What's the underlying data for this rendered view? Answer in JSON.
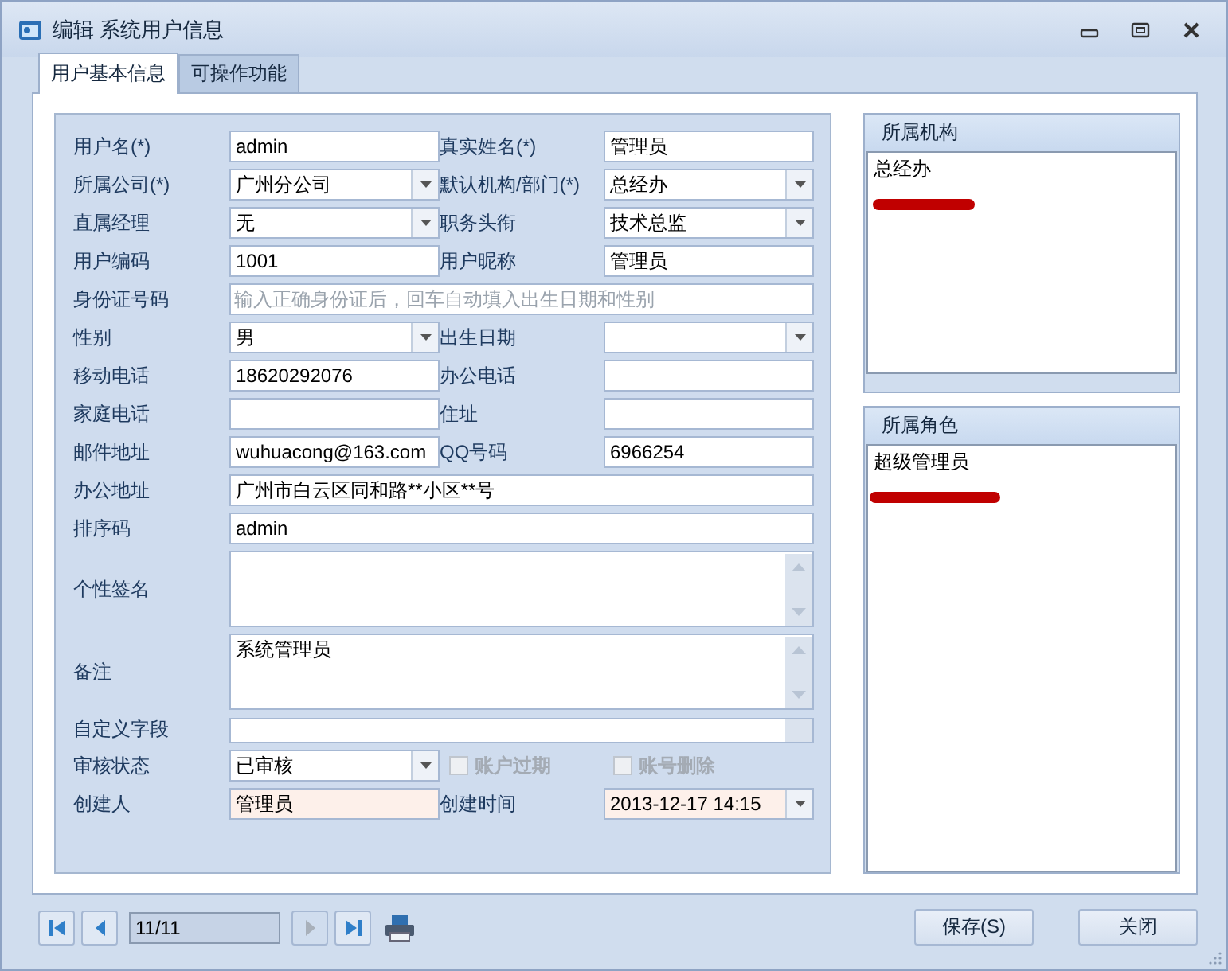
{
  "window": {
    "title": "编辑 系统用户信息"
  },
  "tabs": [
    {
      "label": "用户基本信息",
      "selected": true
    },
    {
      "label": "可操作功能",
      "selected": false
    }
  ],
  "form": {
    "rows": [
      {
        "cells": [
          {
            "label": "用户名(*)",
            "field": {
              "kind": "text",
              "value": "admin",
              "readonly": false
            }
          },
          {
            "label": "真实姓名(*)",
            "field": {
              "kind": "text",
              "value": "管理员",
              "readonly": false
            }
          }
        ]
      },
      {
        "cells": [
          {
            "label": "所属公司(*)",
            "field": {
              "kind": "combo",
              "value": "广州分公司",
              "readonly": false
            }
          },
          {
            "label": "默认机构/部门(*)",
            "field": {
              "kind": "combo",
              "value": "总经办",
              "readonly": false
            }
          }
        ]
      },
      {
        "cells": [
          {
            "label": "直属经理",
            "field": {
              "kind": "combo",
              "value": "无",
              "readonly": false
            }
          },
          {
            "label": "职务头衔",
            "field": {
              "kind": "combo",
              "value": "技术总监",
              "readonly": false
            }
          }
        ]
      },
      {
        "cells": [
          {
            "label": "用户编码",
            "field": {
              "kind": "text",
              "value": "1001",
              "readonly": false
            }
          },
          {
            "label": "用户昵称",
            "field": {
              "kind": "text",
              "value": "管理员",
              "readonly": false
            }
          }
        ]
      },
      {
        "cells": [
          {
            "label": "身份证号码",
            "field": {
              "kind": "text",
              "placeholder": "输入正确身份证后，回车自动填入出生日期和性别",
              "readonly": false
            }
          }
        ]
      },
      {
        "cells": [
          {
            "label": "性别",
            "field": {
              "kind": "combo",
              "value": "男",
              "readonly": false
            }
          },
          {
            "label": "出生日期",
            "field": {
              "kind": "combo",
              "readonly": false
            }
          }
        ]
      },
      {
        "cells": [
          {
            "label": "移动电话",
            "field": {
              "kind": "text",
              "value": "18620292076",
              "readonly": false
            }
          },
          {
            "label": "办公电话",
            "field": {
              "kind": "text",
              "readonly": false
            }
          }
        ]
      },
      {
        "cells": [
          {
            "label": "家庭电话",
            "field": {
              "kind": "text",
              "readonly": false
            }
          },
          {
            "label": "住址",
            "field": {
              "kind": "text",
              "readonly": false
            }
          }
        ]
      },
      {
        "cells": [
          {
            "label": "邮件地址",
            "field": {
              "kind": "text",
              "value": "wuhuacong@163.com",
              "readonly": false
            }
          },
          {
            "label": "QQ号码",
            "field": {
              "kind": "text",
              "value": "6966254",
              "readonly": false
            }
          }
        ]
      },
      {
        "cells": [
          {
            "label": "办公地址",
            "field": {
              "kind": "text",
              "value": "广州市白云区同和路**小区**号",
              "readonly": false
            }
          }
        ]
      },
      {
        "cells": [
          {
            "label": "排序码",
            "field": {
              "kind": "text",
              "value": "admin",
              "readonly": false
            }
          }
        ]
      },
      {
        "cells": [
          {
            "label": "个性签名",
            "field": {
              "kind": "memo",
              "readonly": false
            }
          }
        ]
      },
      {
        "cells": [
          {
            "label": "备注",
            "field": {
              "kind": "memo",
              "value": "系统管理员",
              "readonly": false
            }
          }
        ]
      },
      {
        "cells": [
          {
            "label": "自定义字段",
            "field": {
              "kind": "strip",
              "readonly": false
            }
          }
        ]
      },
      {
        "cells": [
          {
            "label": "审核状态",
            "field": {
              "kind": "combo",
              "value": "已审核",
              "readonly": false
            }
          },
          {
            "field": {
              "kind": "checkbox",
              "label": "账户过期",
              "checked": false,
              "disabled": true
            }
          },
          {
            "field": {
              "kind": "checkbox",
              "label": "账号删除",
              "checked": false,
              "disabled": true
            }
          }
        ]
      },
      {
        "cells": [
          {
            "label": "创建人",
            "field": {
              "kind": "text",
              "value": "管理员",
              "readonly": true
            }
          },
          {
            "label": "创建时间",
            "field": {
              "kind": "combo",
              "value": "2013-12-17 14:15",
              "readonly": true
            }
          }
        ]
      }
    ]
  },
  "groups": [
    {
      "title": "所属机构",
      "items": [
        "总经办"
      ]
    },
    {
      "title": "所属角色",
      "items": [
        "超级管理员"
      ]
    }
  ],
  "pager": {
    "value": "11/11"
  },
  "buttons": [
    "保存(S)",
    "关闭"
  ]
}
